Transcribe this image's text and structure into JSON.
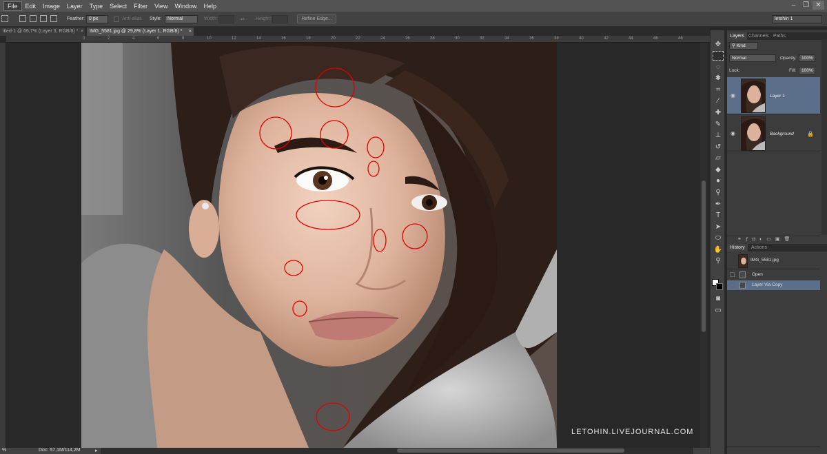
{
  "menu": [
    "File",
    "Edit",
    "Image",
    "Layer",
    "Type",
    "Select",
    "Filter",
    "View",
    "Window",
    "Help"
  ],
  "options": {
    "feather_label": "Feather:",
    "feather_value": "0 px",
    "antialias_label": "Anti-alias",
    "style_label": "Style:",
    "style_value": "Normal",
    "width_label": "Width:",
    "height_label": "Height:",
    "refine_edge": "Refine Edge...",
    "workspace": "letohin 1"
  },
  "tabs": [
    {
      "label": "itled-1 @ 66,7% (Layer 3, RGB/8) *",
      "close": "×"
    },
    {
      "label": "IMG_5581.jpg @ 29,8% (Layer 1, RGB/8) *",
      "close": "×"
    }
  ],
  "ruler_ticks": [
    "0",
    "2",
    "4",
    "6",
    "8",
    "10",
    "12",
    "14",
    "16",
    "18",
    "20",
    "22",
    "24",
    "26",
    "28",
    "30",
    "32",
    "34",
    "36",
    "38",
    "40",
    "42",
    "44",
    "46",
    "48"
  ],
  "watermark": "LETOHIN.LIVEJOURNAL.COM",
  "status": {
    "zoom": "%",
    "doc": "Doc: 57,1M/114,2M"
  },
  "layers_panel": {
    "tabs": [
      "Layers",
      "Channels",
      "Paths"
    ],
    "kind": "Kind",
    "blend_mode": "Normal",
    "opacity_label": "Opacity:",
    "opacity_value": "100%",
    "lock_label": "Lock:",
    "fill_label": "Fill:",
    "fill_value": "100%",
    "layers": [
      {
        "name": "Layer 1",
        "selected": true
      },
      {
        "name": "Background",
        "selected": false
      }
    ]
  },
  "history_panel": {
    "tabs": [
      "History",
      "Actions"
    ],
    "snapshot": "IMG_5581.jpg",
    "states": [
      {
        "name": "Open",
        "selected": false
      },
      {
        "name": "Layer Via Copy",
        "selected": true
      }
    ]
  },
  "colors": {
    "accent_selection": "#5b6f8a",
    "annotation": "#e00000"
  }
}
